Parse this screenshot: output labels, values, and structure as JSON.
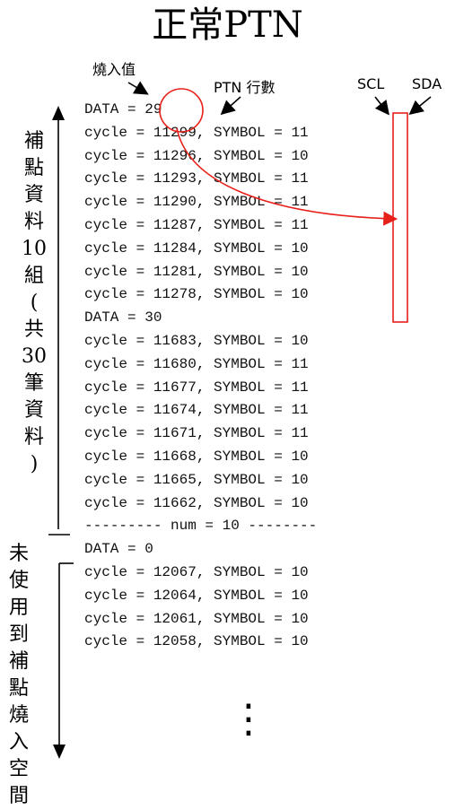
{
  "title": "正常PTN",
  "annotations": {
    "burn_value": "燒入值",
    "ptn_rows": "PTN 行數",
    "scl": "SCL",
    "sda": "SDA"
  },
  "side_labels": {
    "fill_data": [
      "補",
      "點",
      "資",
      "料",
      "10",
      "組",
      "(",
      "共",
      "30",
      "筆",
      "資",
      "料",
      ")"
    ],
    "unused": [
      "未",
      "使",
      "用",
      "到",
      "補",
      "點",
      "燒",
      "入",
      "空",
      "間"
    ]
  },
  "code_lines": [
    "DATA = 29",
    "cycle = 11299, SYMBOL = 11",
    "cycle = 11296, SYMBOL = 10",
    "cycle = 11293, SYMBOL = 11",
    "cycle = 11290, SYMBOL = 11",
    "cycle = 11287, SYMBOL = 11",
    "cycle = 11284, SYMBOL = 10",
    "cycle = 11281, SYMBOL = 10",
    "cycle = 11278, SYMBOL = 10",
    "DATA = 30",
    "cycle = 11683, SYMBOL = 10",
    "cycle = 11680, SYMBOL = 11",
    "cycle = 11677, SYMBOL = 11",
    "cycle = 11674, SYMBOL = 11",
    "cycle = 11671, SYMBOL = 11",
    "cycle = 11668, SYMBOL = 10",
    "cycle = 11665, SYMBOL = 10",
    "cycle = 11662, SYMBOL = 10",
    "--------- num = 10 --------",
    "DATA = 0",
    "cycle = 12067, SYMBOL = 10",
    "cycle = 12064, SYMBOL = 10",
    "cycle = 12061, SYMBOL = 10",
    "cycle = 12058, SYMBOL = 10"
  ],
  "ellipsis": "⋮",
  "colors": {
    "highlight": "#e8201a",
    "text": "#111111"
  }
}
